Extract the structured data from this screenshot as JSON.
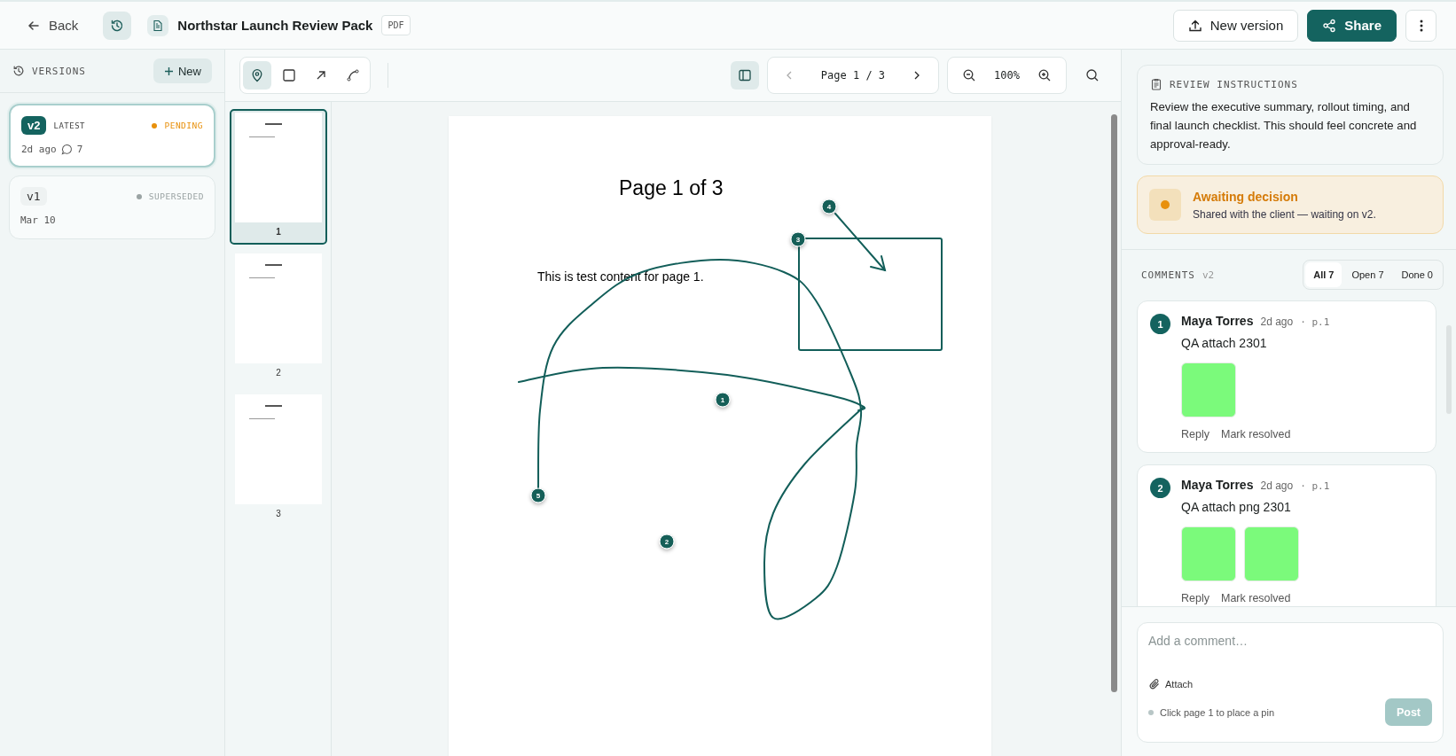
{
  "header": {
    "back": "Back",
    "title": "Northstar Launch Review Pack",
    "file_type": "PDF",
    "new_version": "New version",
    "share": "Share"
  },
  "versions": {
    "heading": "VERSIONS",
    "new": "New",
    "items": [
      {
        "tag": "v2",
        "badge": "LATEST",
        "status": "PENDING",
        "color": "#e8900c",
        "date": "2d ago",
        "comments": "7",
        "selected": true
      },
      {
        "tag": "v1",
        "status": "SUPERSEDED",
        "color": "#9aa3a3",
        "date": "Mar 10",
        "selected": false
      }
    ]
  },
  "tools": [
    {
      "kind": "pin",
      "selected": true
    },
    {
      "kind": "rect",
      "selected": false
    },
    {
      "kind": "arrow",
      "selected": false
    },
    {
      "kind": "draw",
      "selected": false
    }
  ],
  "thumbnails_toggle": {
    "selected": true
  },
  "pager": "Page 1 / 3",
  "zoom": "100%",
  "thumbnails": [
    {
      "number": "1",
      "selected": true
    },
    {
      "number": "2",
      "selected": false
    },
    {
      "number": "3",
      "selected": false
    }
  ],
  "page": {
    "title": "Page 1 of 3",
    "body": "This is test content for page 1.",
    "annotations": [
      {
        "kind": "pin",
        "label": "1"
      },
      {
        "kind": "pin",
        "label": "2"
      },
      {
        "kind": "rect",
        "label": "3"
      },
      {
        "kind": "arrow",
        "label": "4"
      },
      {
        "kind": "stroke",
        "label": "5"
      }
    ]
  },
  "instructions": {
    "heading": "REVIEW INSTRUCTIONS",
    "text": "Review the executive summary, rollout timing, and final launch checklist. This should feel concrete and approval-ready."
  },
  "decision": {
    "title": "Awaiting decision",
    "text": "Shared with the client — waiting on v2."
  },
  "comments": {
    "heading": "COMMENTS",
    "version": "v2",
    "filters": [
      {
        "label": "All 7",
        "selected": true
      },
      {
        "label": "Open 7",
        "selected": false
      },
      {
        "label": "Done 0",
        "selected": false
      }
    ],
    "items": [
      {
        "number": "1",
        "author": "Maya Torres",
        "time": "2d ago",
        "page": "· p.1",
        "text": "QA attach 2301",
        "attachments": [
          {
            "kind": "image"
          }
        ],
        "reply": "Reply",
        "resolve": "Mark resolved"
      },
      {
        "number": "2",
        "author": "Maya Torres",
        "time": "2d ago",
        "page": "· p.1",
        "text": "QA attach png 2301",
        "attachments": [
          {
            "kind": "image"
          },
          {
            "kind": "image"
          }
        ],
        "reply": "Reply",
        "resolve": "Mark resolved"
      }
    ]
  },
  "composer": {
    "placeholder": "Add a comment…",
    "attach": "Attach",
    "hint": "Click page 1 to place a pin",
    "post": "Post",
    "post_disabled": true
  }
}
